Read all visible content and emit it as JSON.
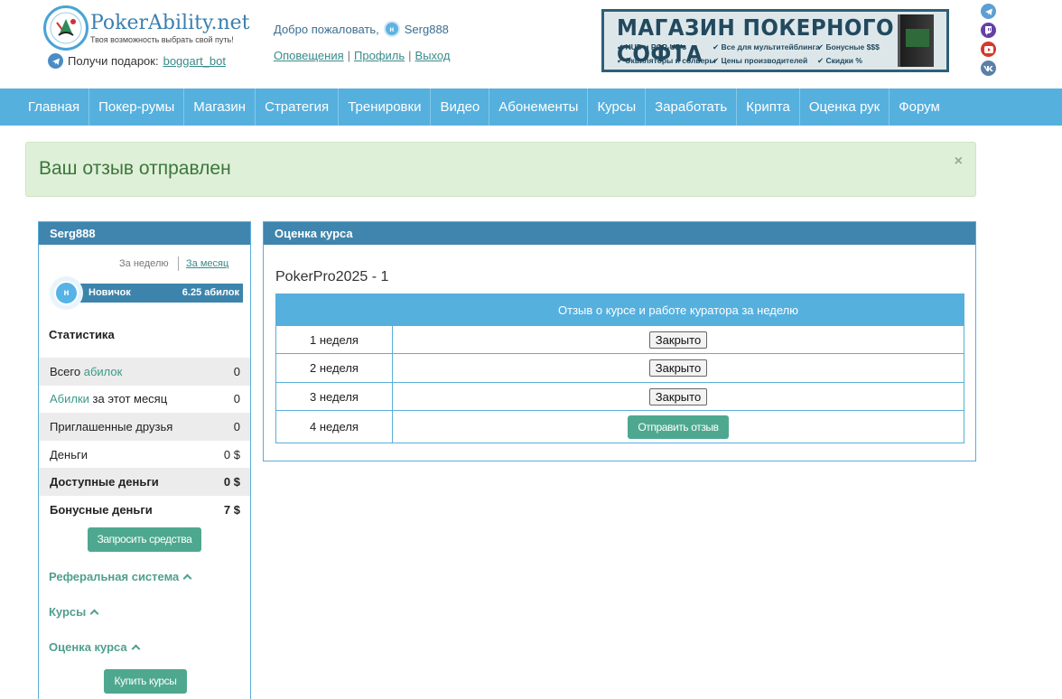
{
  "header": {
    "logo_title": "PokerAbility.net",
    "logo_subtitle": "Твоя возможность выбрать свой путь!",
    "gift_label": "Получи подарок:",
    "gift_link": "boggart_bot",
    "welcome_text": "Добро пожаловать,",
    "username": "Serg888",
    "avatar_letter": "н",
    "links": {
      "notifications": "Оповещения",
      "profile": "Профиль",
      "logout": "Выход"
    },
    "banner": {
      "title": "МАГАЗИН ПОКЕРНОГО СОФТА",
      "col1": [
        "✔ HUD и POP-UP's",
        "✔ Эквиляторы и солверы"
      ],
      "col2": [
        "✔ Все для мультитейблинга",
        "✔ Цены производителей"
      ],
      "col3": [
        "✔ Бонусные $$$",
        "✔ Скидки %"
      ]
    },
    "social_icons": [
      "telegram-icon",
      "twitch-icon",
      "youtube-icon",
      "vk-icon"
    ]
  },
  "nav": {
    "items": [
      "Главная",
      "Покер-румы",
      "Магазин",
      "Стратегия",
      "Тренировки",
      "Видео",
      "Абонементы",
      "Курсы",
      "Заработать",
      "Крипта",
      "Оценка рук",
      "Форум"
    ]
  },
  "alert": {
    "message": "Ваш отзыв отправлен",
    "close": "×"
  },
  "sidebar": {
    "username": "Serg888",
    "period_week": "За неделю",
    "period_month": "За месяц",
    "rank_letter": "н",
    "rank_name": "Новичок",
    "rank_points": "6.25 абилок",
    "stats_title": "Статистика",
    "stats": {
      "total_prefix": "Всего",
      "total_hl": "абилок",
      "total_value": "0",
      "month_hl": "Абилки",
      "month_suffix": "за этот месяц",
      "month_value": "0",
      "friends_label": "Приглашенные друзья",
      "friends_value": "0",
      "money_label": "Деньги",
      "money_value": "0 $",
      "available_label": "Доступные деньги",
      "available_value": "0 $",
      "bonus_label": "Бонусные деньги",
      "bonus_value": "7 $"
    },
    "request_button": "Запросить средства",
    "referral": "Реферальная система",
    "courses": "Курсы",
    "course_rating": "Оценка курса",
    "buy_button": "Купить курсы"
  },
  "main": {
    "panel_title": "Оценка курса",
    "course_name": "PokerPro2025 - 1",
    "table_header": "Отзыв о курсе и работе куратора за неделю",
    "rows": [
      {
        "week": "1 неделя",
        "action": "Закрыто"
      },
      {
        "week": "2 неделя",
        "action": "Закрыто"
      },
      {
        "week": "3 неделя",
        "action": "Закрыто"
      },
      {
        "week": "4 неделя",
        "action": "Отправить отзыв"
      }
    ]
  },
  "colors": {
    "nav": "#55b0de",
    "panel_head": "#3f85ad",
    "accent_green": "#4ea88f",
    "alert_bg": "#dff0d8",
    "alert_text": "#3c763d"
  }
}
